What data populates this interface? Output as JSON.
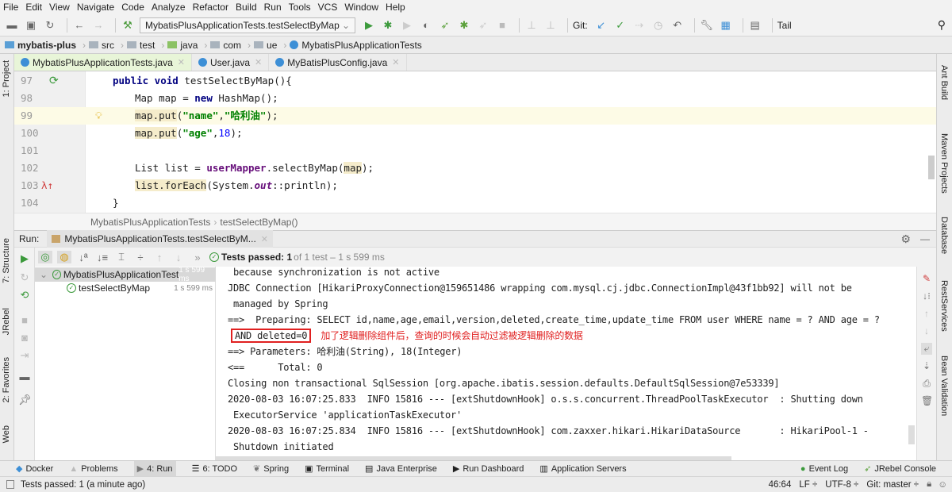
{
  "menu": [
    "File",
    "Edit",
    "View",
    "Navigate",
    "Code",
    "Analyze",
    "Refactor",
    "Build",
    "Run",
    "Tools",
    "VCS",
    "Window",
    "Help"
  ],
  "toolbar": {
    "run_config": "MybatisPlusApplicationTests.testSelectByMap",
    "git_label": "Git:",
    "tail_label": "Tail"
  },
  "nav_breadcrumb": [
    "mybatis-plus",
    "src",
    "test",
    "java",
    "com",
    "ue",
    "MybatisPlusApplicationTests"
  ],
  "left_stripe": [
    "1: Project",
    "7: Structure",
    "JRebel",
    "2: Favorites",
    "Web"
  ],
  "right_stripe": [
    "Ant Build",
    "Maven Projects",
    "Database",
    "RestServices",
    "Bean Validation"
  ],
  "editor_tabs": [
    "MybatisPlusApplicationTests.java",
    "User.java",
    "MyBatisPlusConfig.java"
  ],
  "code": {
    "line_numbers": [
      "97",
      "98",
      "99",
      "100",
      "101",
      "102",
      "103",
      "104"
    ],
    "l97": {
      "a": "public void ",
      "b": "testSelectByMap(){"
    },
    "l98": {
      "a": "Map map = ",
      "b": "new ",
      "c": "HashMap();"
    },
    "l99": {
      "a": "map.put",
      "b": "(",
      "c": "\"name\"",
      ",": ",",
      "d": "\"哈利油\"",
      "e": ");"
    },
    "l100": {
      "a": "map.put",
      "b": "(",
      "c": "\"age\"",
      "d": ",",
      "e": "18",
      "f": ");"
    },
    "l102": {
      "a": "List list = ",
      "b": "userMapper",
      ".": ".selectByMap(",
      "c": "map",
      "d": ");"
    },
    "l103": {
      "a": "list.forEach",
      "b": "(System.",
      "c": "out",
      "d": "::println);"
    },
    "l104": "}"
  },
  "editor_breadcrumb": [
    "MybatisPlusApplicationTests",
    "testSelectByMap()"
  ],
  "run": {
    "label": "Run:",
    "tab": "MybatisPlusApplicationTests.testSelectByM...",
    "status_bold": "Tests passed: 1",
    "status_rest": " of 1 test – 1 s 599 ms",
    "tree": [
      {
        "name": "MybatisPlusApplicationTest",
        "time": "1 s 599 ms"
      },
      {
        "name": "testSelectByMap",
        "time": "1 s 599 ms"
      }
    ]
  },
  "console": {
    "lines": [
      " because synchronization is not active",
      "JDBC Connection [HikariProxyConnection@159651486 wrapping com.mysql.cj.jdbc.ConnectionImpl@43f1bb92] will not be",
      " managed by Spring",
      "==>  Preparing: SELECT id,name,age,email,version,deleted,create_time,update_time FROM user WHERE name = ? AND age = ?",
      "AND deleted=0",
      "==> Parameters: 哈利油(String), 18(Integer)",
      "<==      Total: 0",
      "Closing non transactional SqlSession [org.apache.ibatis.session.defaults.DefaultSqlSession@7e53339]",
      "2020-08-03 16:07:25.833  INFO 15816 --- [extShutdownHook] o.s.s.concurrent.ThreadPoolTaskExecutor  : Shutting down",
      " ExecutorService 'applicationTaskExecutor'",
      "2020-08-03 16:07:25.834  INFO 15816 --- [extShutdownHook] com.zaxxer.hikari.HikariDataSource       : HikariPool-1 -",
      " Shutdown initiated"
    ],
    "annotation": "加了逻辑删除组件后，查询的时候会自动过滤被逻辑删除的数据"
  },
  "bottom_tools": [
    "Docker",
    "Problems",
    "4: Run",
    "6: TODO",
    "Spring",
    "Terminal",
    "Java Enterprise",
    "Run Dashboard",
    "Application Servers"
  ],
  "bottom_right": [
    "Event Log",
    "JRebel Console"
  ],
  "status": {
    "message": "Tests passed: 1 (a minute ago)",
    "position": "46:64",
    "line_sep": "LF ÷",
    "encoding": "UTF-8 ÷",
    "git": "Git: master ÷"
  },
  "colors": {
    "accent_green": "#3c9a3c",
    "annotation_red": "#e02020"
  }
}
